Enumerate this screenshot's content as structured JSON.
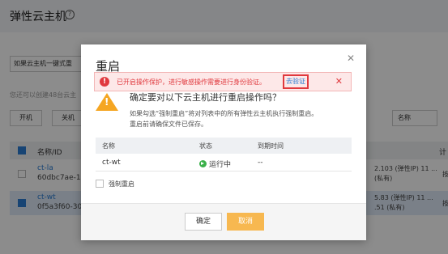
{
  "background": {
    "page_title": "弹性云主机",
    "help_icon": "question-circle-icon",
    "tab_button": "如果云主机一键式重",
    "quota_text": "您还可以创建48台云主",
    "toolbar": {
      "start": "开机",
      "stop": "关机",
      "filter_select": "名称"
    },
    "table": {
      "header_name": "名称/ID",
      "header_right": "计",
      "rows": [
        {
          "name": "ct-la",
          "id": "60dbc7ae-1",
          "ip_line1": "2.103  (弹性IP) 11 ...",
          "ip_line2": "(私有)",
          "extra": "按"
        },
        {
          "name": "ct-wt",
          "id": "0f5a3f60-30",
          "ip_line1": "5.83  (弹性IP) 11 ...",
          "ip_line2": ".51  (私有)",
          "extra": "按"
        }
      ]
    }
  },
  "modal": {
    "title": "重启",
    "close_icon": "close-icon",
    "alert": {
      "text": "已开启操作保护，进行敏感操作需要进行身份验证。",
      "link": "去验证",
      "close": "✕"
    },
    "confirm_question": "确定要对以下云主机进行重启操作吗？",
    "desc_line1": "如果勾选“强制重启”将对列表中的所有弹性云主机执行强制重启。",
    "desc_line2": "重启前请确保文件已保存。",
    "table": {
      "headers": {
        "name": "名称",
        "status": "状态",
        "expire": "到期时间"
      },
      "row": {
        "name": "ct-wt",
        "status": "运行中",
        "expire": "--"
      }
    },
    "force_restart_label": "强制重启",
    "ok_button": "确定",
    "cancel_button": "取消"
  },
  "colors": {
    "alert_red": "#e0393e",
    "link_blue": "#2b7cd3",
    "cancel_orange": "#f7b850",
    "status_green": "#3bb04a",
    "warning_orange": "#f5a623"
  }
}
